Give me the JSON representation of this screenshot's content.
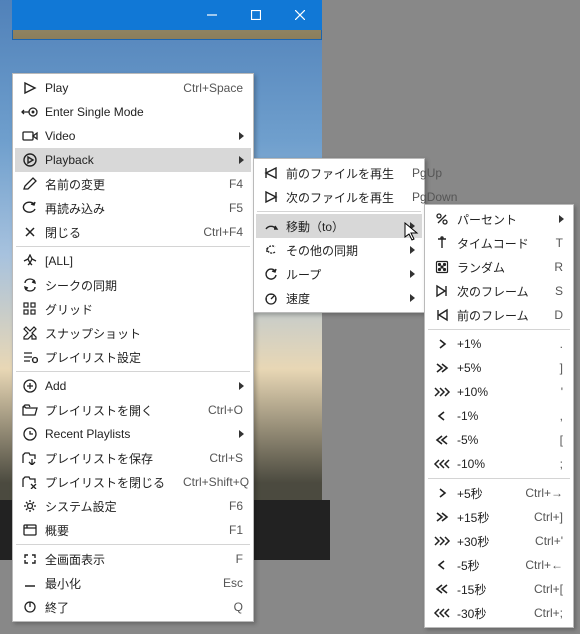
{
  "titlebar": {
    "min": "minimize",
    "max": "maximize",
    "close": "close"
  },
  "menu1": [
    {
      "icon": "play",
      "label": "Play",
      "shortcut": "Ctrl+Space"
    },
    {
      "icon": "single",
      "label": "Enter Single Mode"
    },
    {
      "icon": "video",
      "label": "Video",
      "sub": true
    },
    {
      "icon": "playback",
      "label": "Playback",
      "sub": true,
      "hover": true
    },
    {
      "icon": "rename",
      "label": "名前の変更",
      "shortcut": "F4"
    },
    {
      "icon": "reload",
      "label": "再読み込み",
      "shortcut": "F5"
    },
    {
      "icon": "close",
      "label": "閉じる",
      "shortcut": "Ctrl+F4"
    },
    {
      "sep": true
    },
    {
      "icon": "all",
      "label": "[ALL]"
    },
    {
      "icon": "sync",
      "label": "シークの同期"
    },
    {
      "icon": "grid",
      "label": "グリッド"
    },
    {
      "icon": "snap",
      "label": "スナップショット"
    },
    {
      "icon": "plset",
      "label": "プレイリスト設定"
    },
    {
      "sep": true
    },
    {
      "icon": "add",
      "label": "Add",
      "sub": true
    },
    {
      "icon": "open",
      "label": "プレイリストを開く",
      "shortcut": "Ctrl+O"
    },
    {
      "icon": "recent",
      "label": "Recent Playlists",
      "sub": true
    },
    {
      "icon": "save",
      "label": "プレイリストを保存",
      "shortcut": "Ctrl+S"
    },
    {
      "icon": "closepl",
      "label": "プレイリストを閉じる",
      "shortcut": "Ctrl+Shift+Q"
    },
    {
      "icon": "gear",
      "label": "システム設定",
      "shortcut": "F6"
    },
    {
      "icon": "info",
      "label": "概要",
      "shortcut": "F1"
    },
    {
      "sep": true
    },
    {
      "icon": "full",
      "label": "全画面表示",
      "shortcut": "F"
    },
    {
      "icon": "min",
      "label": "最小化",
      "shortcut": "Esc"
    },
    {
      "icon": "exit",
      "label": "終了",
      "shortcut": "Q"
    }
  ],
  "menu2": [
    {
      "icon": "prev",
      "label": "前のファイルを再生",
      "shortcut": "PgUp"
    },
    {
      "icon": "next",
      "label": "次のファイルを再生",
      "shortcut": "PgDown"
    },
    {
      "sep": true
    },
    {
      "icon": "moveto",
      "label": "移動（to）",
      "sub": true,
      "hover": true
    },
    {
      "icon": "othersync",
      "label": "その他の同期",
      "sub": true
    },
    {
      "icon": "loop",
      "label": "ループ",
      "sub": true
    },
    {
      "icon": "speed",
      "label": "速度",
      "sub": true
    }
  ],
  "menu3": [
    {
      "icon": "pct",
      "label": "パーセント",
      "sub": true
    },
    {
      "icon": "tc",
      "label": "タイムコード",
      "shortcut": "T"
    },
    {
      "icon": "rand",
      "label": "ランダム",
      "shortcut": "R"
    },
    {
      "icon": "nextf",
      "label": "次のフレーム",
      "shortcut": "S"
    },
    {
      "icon": "prevf",
      "label": "前のフレーム",
      "shortcut": "D"
    },
    {
      "sep": true
    },
    {
      "icon": "r1",
      "label": "+1%",
      "shortcut": "."
    },
    {
      "icon": "r2",
      "label": "+5%",
      "shortcut": "]"
    },
    {
      "icon": "r3",
      "label": "+10%",
      "shortcut": "'"
    },
    {
      "icon": "l1",
      "label": "-1%",
      "shortcut": ","
    },
    {
      "icon": "l2",
      "label": "-5%",
      "shortcut": "["
    },
    {
      "icon": "l3",
      "label": "-10%",
      "shortcut": ";"
    },
    {
      "sep": true
    },
    {
      "icon": "r1",
      "label": "+5秒",
      "shortcut": "Ctrl+→"
    },
    {
      "icon": "r2",
      "label": "+15秒",
      "shortcut": "Ctrl+]"
    },
    {
      "icon": "r3",
      "label": "+30秒",
      "shortcut": "Ctrl+'"
    },
    {
      "icon": "l1",
      "label": "-5秒",
      "shortcut": "Ctrl+←"
    },
    {
      "icon": "l2",
      "label": "-15秒",
      "shortcut": "Ctrl+["
    },
    {
      "icon": "l3",
      "label": "-30秒",
      "shortcut": "Ctrl+;"
    }
  ]
}
